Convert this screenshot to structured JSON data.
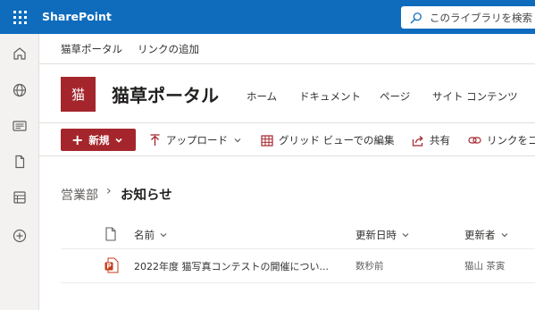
{
  "suite": {
    "brand": "SharePoint",
    "search_placeholder": "このライブラリを検索"
  },
  "app_bar": {
    "icons": [
      "home-icon",
      "globe-icon",
      "news-icon",
      "file-icon",
      "lists-icon",
      "create-icon"
    ]
  },
  "hub": {
    "items": [
      "猫草ポータル",
      "リンクの追加"
    ]
  },
  "site": {
    "logo_text": "猫",
    "title": "猫草ポータル",
    "nav": [
      "ホーム",
      "ドキュメント",
      "ページ",
      "サイト コンテンツ"
    ]
  },
  "command_bar": {
    "new_label": "新規",
    "upload_label": "アップロード",
    "grid_edit_label": "グリッド ビューでの編集",
    "share_label": "共有",
    "copy_link_label": "リンクをコ"
  },
  "breadcrumb": {
    "parent": "営業部",
    "current": "お知らせ"
  },
  "list": {
    "columns": {
      "name": "名前",
      "modified": "更新日時",
      "modified_by": "更新者"
    },
    "rows": [
      {
        "name": "2022年度 猫写真コンテストの開催につい...",
        "modified": "数秒前",
        "modified_by": "猫山 茶寅",
        "icon": "powerpoint-file-icon"
      }
    ]
  },
  "colors": {
    "suite_bar": "#0f6cbd",
    "accent": "#a4262c",
    "app_bar_bg": "#f3f2f1"
  }
}
